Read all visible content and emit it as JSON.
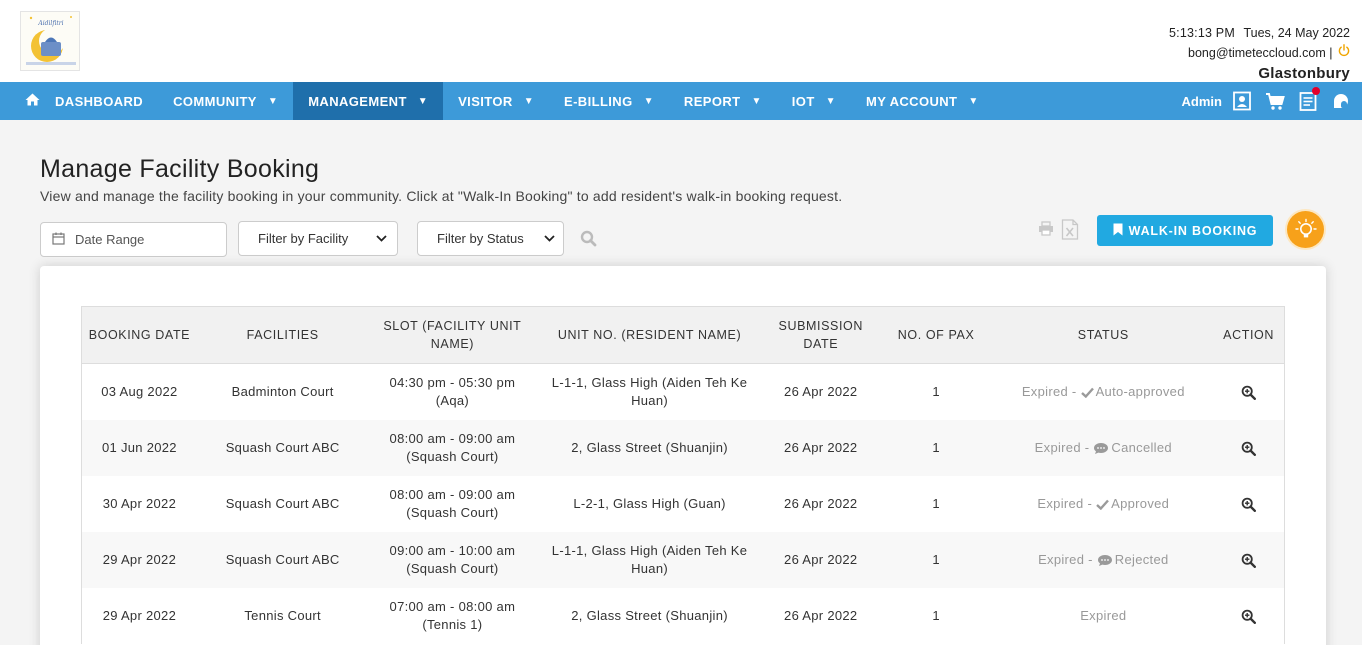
{
  "header": {
    "time": "5:13:13 PM",
    "date": "Tues, 24 May 2022",
    "email": "bong@timeteccloud.com",
    "separator": "|",
    "organization": "Glastonbury",
    "logo_text": "Hello Aidilfitri"
  },
  "nav": {
    "items": [
      {
        "label": "DASHBOARD",
        "icon": "home-icon",
        "dropdown": false
      },
      {
        "label": "COMMUNITY",
        "dropdown": true
      },
      {
        "label": "MANAGEMENT",
        "dropdown": true,
        "active": true
      },
      {
        "label": "VISITOR",
        "dropdown": true
      },
      {
        "label": "E-BILLING",
        "dropdown": true
      },
      {
        "label": "REPORT",
        "dropdown": true
      },
      {
        "label": "IOT",
        "dropdown": true
      },
      {
        "label": "MY ACCOUNT",
        "dropdown": true
      }
    ],
    "user_label": "Admin",
    "right_icons": [
      "profile-card-icon",
      "cart-icon",
      "news-icon",
      "chat-icon"
    ]
  },
  "page": {
    "title": "Manage Facility Booking",
    "description": "View and manage the facility booking in your community. Click at \"Walk-In Booking\" to add resident's walk-in booking request."
  },
  "filters": {
    "date_placeholder": "Date Range",
    "facility_selected": "Filter by Facility",
    "status_selected": "Filter by Status"
  },
  "actions": {
    "walkin_label": "WALK-IN BOOKING"
  },
  "table": {
    "headers": [
      "BOOKING DATE",
      "FACILITIES",
      "SLOT (FACILITY UNIT NAME)",
      "UNIT NO. (RESIDENT NAME)",
      "SUBMISSION DATE",
      "NO. OF PAX",
      "STATUS",
      "ACTION"
    ],
    "rows": [
      {
        "booking_date": "03 Aug 2022",
        "facility": "Badminton Court",
        "slot": "04:30 pm - 05:30 pm (Aqa)",
        "unit": "L-1-1, Glass High (Aiden Teh Ke Huan)",
        "submission_date": "26 Apr 2022",
        "pax": "1",
        "status_prefix": "Expired -",
        "status_icon": "check-icon",
        "status_label": "Auto-approved"
      },
      {
        "booking_date": "01 Jun 2022",
        "facility": "Squash Court ABC",
        "slot": "08:00 am - 09:00 am (Squash Court)",
        "unit": "2, Glass Street (Shuanjin)",
        "submission_date": "26 Apr 2022",
        "pax": "1",
        "status_prefix": "Expired -",
        "status_icon": "comment-icon",
        "status_label": "Cancelled"
      },
      {
        "booking_date": "30 Apr 2022",
        "facility": "Squash Court ABC",
        "slot": "08:00 am - 09:00 am (Squash Court)",
        "unit": "L-2-1, Glass High (Guan)",
        "submission_date": "26 Apr 2022",
        "pax": "1",
        "status_prefix": "Expired -",
        "status_icon": "check-icon",
        "status_label": "Approved"
      },
      {
        "booking_date": "29 Apr 2022",
        "facility": "Squash Court ABC",
        "slot": "09:00 am - 10:00 am (Squash Court)",
        "unit": "L-1-1, Glass High (Aiden Teh Ke Huan)",
        "submission_date": "26 Apr 2022",
        "pax": "1",
        "status_prefix": "Expired -",
        "status_icon": "comment-icon",
        "status_label": "Rejected"
      },
      {
        "booking_date": "29 Apr 2022",
        "facility": "Tennis Court",
        "slot": "07:00 am - 08:00 am (Tennis 1)",
        "unit": "2, Glass Street (Shuanjin)",
        "submission_date": "26 Apr 2022",
        "pax": "1",
        "status_prefix": "Expired",
        "status_icon": "",
        "status_label": ""
      }
    ]
  },
  "colors": {
    "nav_bg": "#3d9ad9",
    "nav_active": "#1f6fab",
    "walkin_button": "#21a9e1",
    "bulb": "#f7a11a",
    "power_icon": "#f0a500"
  }
}
